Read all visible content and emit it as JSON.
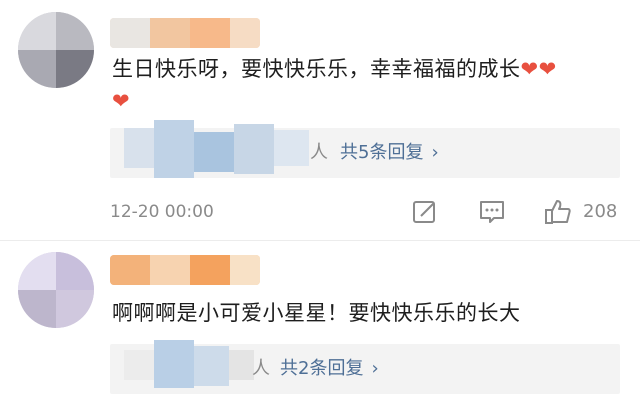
{
  "comments": [
    {
      "text": "生日快乐呀，要快快乐乐，幸幸福福的成长",
      "hearts": [
        "❤",
        "❤",
        "❤"
      ],
      "reply_count": "共5条回复",
      "reply_snippet": "人",
      "chevron": "›",
      "timestamp": "12-20 00:00",
      "likes": "208"
    },
    {
      "text": "啊啊啊是小可爱小星星！要快快乐乐的长大",
      "reply_count": "共2条回复",
      "reply_snippet": "人",
      "chevron": "›"
    }
  ],
  "icons": {
    "edit": "edit-icon",
    "comment": "comment-icon",
    "like": "thumbs-up-icon"
  },
  "colors": {
    "heart": "#e8503f",
    "reply_link": "#4e6f96",
    "reply_bg": "#f3f3f3",
    "meta": "#8a8a8a"
  }
}
